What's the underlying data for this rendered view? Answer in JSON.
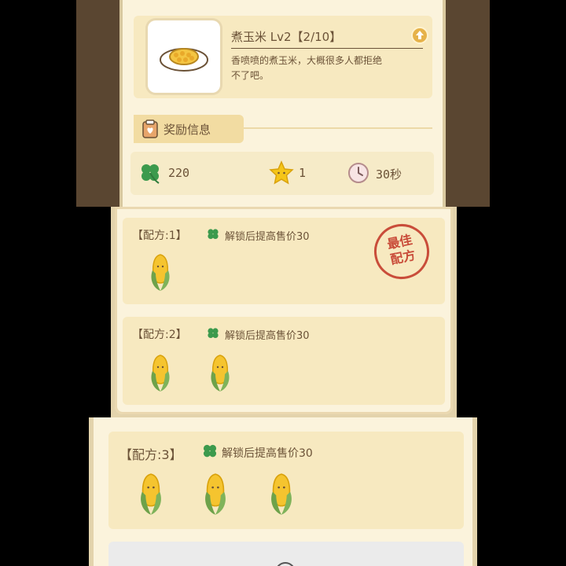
{
  "item": {
    "name": "煮玉米 Lv2【2/10】",
    "description_line1": "香喷喷的煮玉米，大概很多人都拒绝",
    "description_line2": "不了吧。"
  },
  "reward": {
    "section_title": "奖励信息",
    "clover_value": "220",
    "star_value": "1",
    "time_value": "30秒"
  },
  "recipes": [
    {
      "label": "【配方:1】",
      "bonus": "解锁后提高售价30",
      "corn_count": 1
    },
    {
      "label": "【配方:2】",
      "bonus": "解锁后提高售价30",
      "corn_count": 2
    },
    {
      "label": "【配方:3】",
      "bonus": "解锁后提高售价30",
      "corn_count": 3
    }
  ],
  "stamp": {
    "line1": "最佳",
    "line2": "配方"
  },
  "colors": {
    "panel": "#fbf3dc",
    "card": "#f7e9c0",
    "text": "#6b5237",
    "clover": "#3c9a4d",
    "star": "#f5c518",
    "stamp": "#c94d3a",
    "upgrade": "#e6b24a"
  }
}
